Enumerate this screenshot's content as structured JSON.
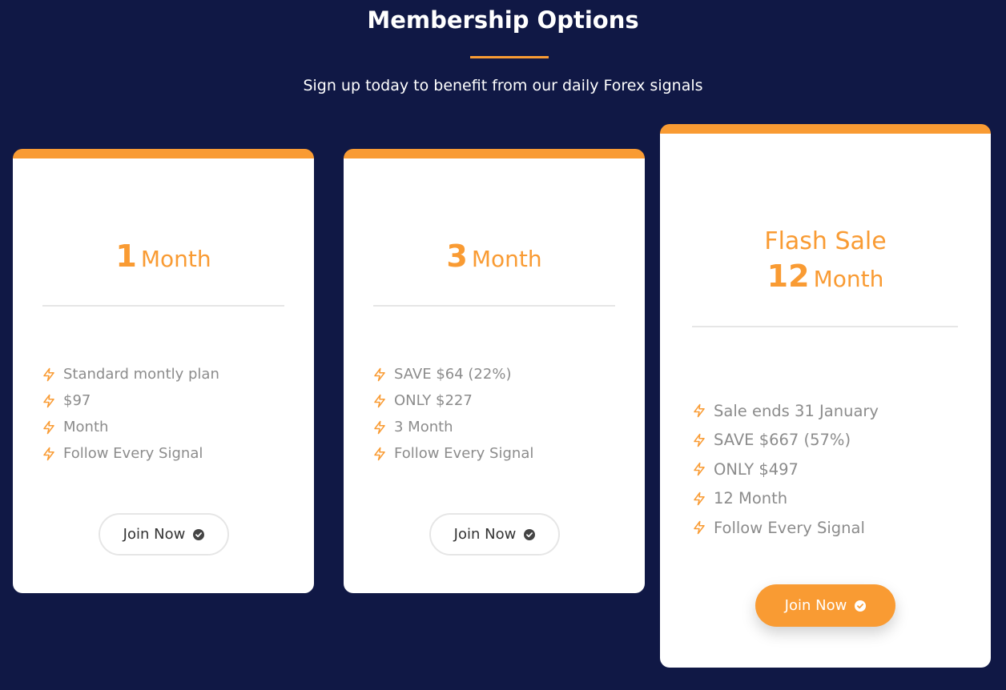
{
  "header": {
    "title": "Membership Options",
    "subtitle": "Sign up today to benefit from our daily Forex signals"
  },
  "colors": {
    "background": "#101845",
    "accent": "#f99b33",
    "card": "#ffffff",
    "feature_text": "#8c8c8c"
  },
  "plans": [
    {
      "sale_label": "",
      "duration_number": "1",
      "duration_unit": "Month",
      "features": [
        "Standard montly plan",
        "$97",
        "Month",
        "Follow Every Signal"
      ],
      "button_label": "Join Now",
      "button_icon": "check-circle-icon"
    },
    {
      "sale_label": "",
      "duration_number": "3",
      "duration_unit": "Month",
      "features": [
        "SAVE $64 (22%)",
        "ONLY $227",
        "3 Month",
        "Follow Every Signal"
      ],
      "button_label": "Join Now",
      "button_icon": "check-circle-icon"
    },
    {
      "sale_label": "Flash Sale",
      "duration_number": "12",
      "duration_unit": "Month",
      "features": [
        "Sale ends 31 January",
        "SAVE $667 (57%)",
        "ONLY $497",
        "12 Month",
        "Follow Every Signal"
      ],
      "button_label": "Join Now",
      "button_icon": "check-circle-icon"
    }
  ],
  "feature_icon": "lightning-bolt-icon"
}
